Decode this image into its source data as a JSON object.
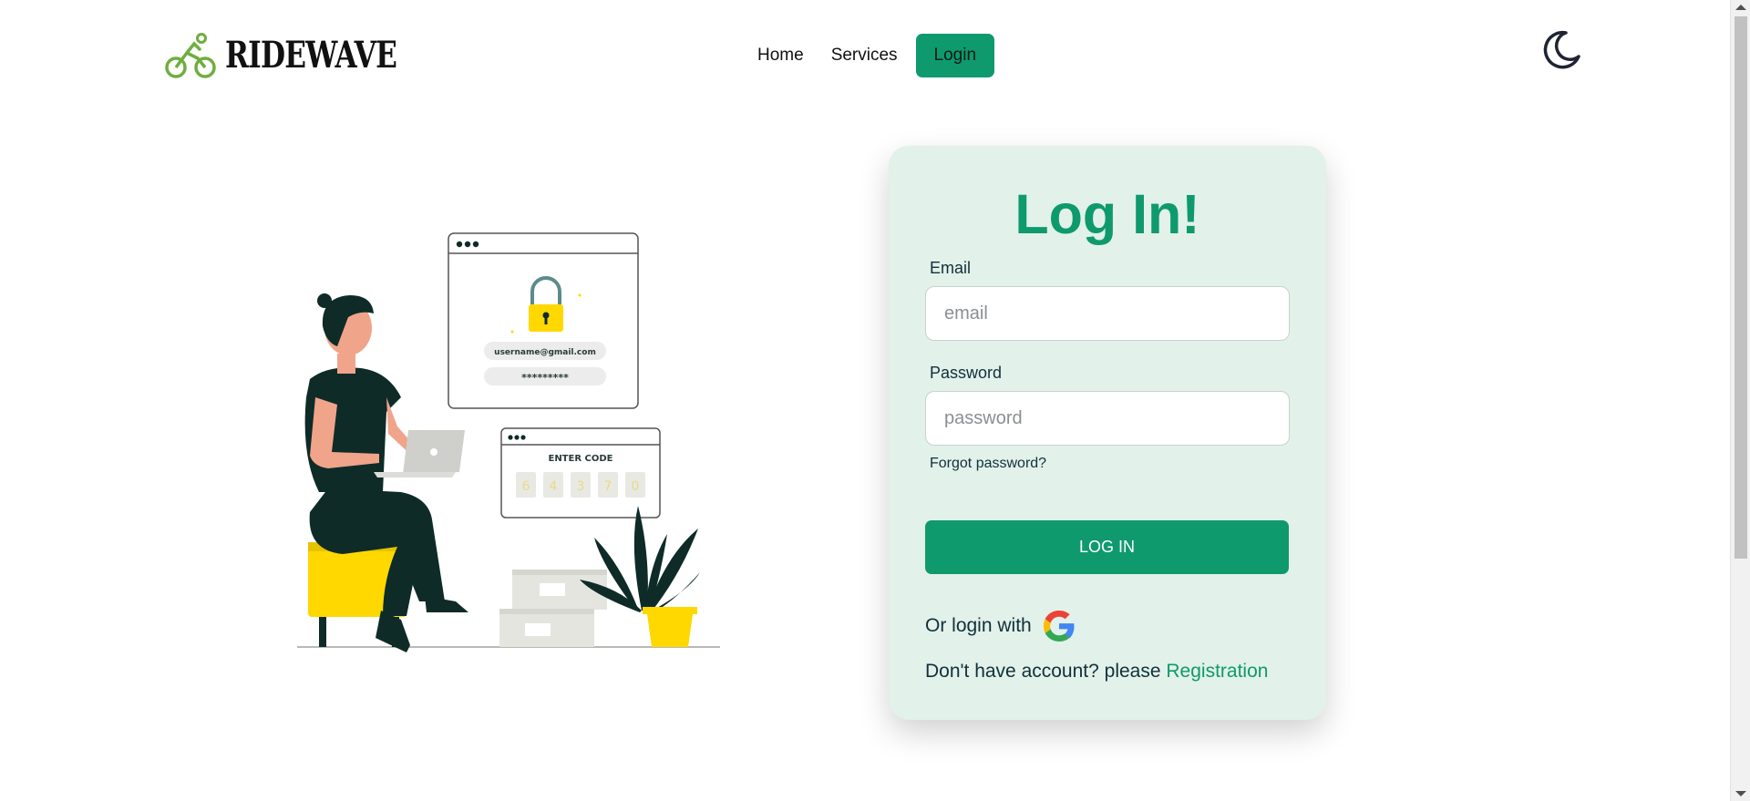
{
  "navbar": {
    "brand_name": "RIDEWAVE",
    "brand_icon": "cyclist-icon",
    "links": [
      {
        "label": "Home"
      },
      {
        "label": "Services"
      },
      {
        "label": "Login",
        "active": true
      }
    ],
    "theme_toggle_icon": "moon-icon"
  },
  "illustration": {
    "description_icon": "login-illustration",
    "email_placeholder": "username@gmail.com",
    "password_mask": "*********",
    "code_title": "ENTER CODE",
    "code_digits": [
      "6",
      "4",
      "3",
      "7",
      "0"
    ]
  },
  "login_card": {
    "title": "Log In!",
    "email_label": "Email",
    "email_placeholder": "email",
    "password_label": "Password",
    "password_placeholder": "password",
    "forgot_password": "Forgot password?",
    "login_button": "LOG IN",
    "alt_login_text": "Or login with",
    "google_icon": "google-icon",
    "register_prompt": "Don't have account? please",
    "register_link": "Registration"
  },
  "colors": {
    "accent": "#0e9a6d",
    "card_background": "#e2f1e9",
    "illustration_yellow": "#ffd800",
    "illustration_dark": "#0e2b28"
  }
}
